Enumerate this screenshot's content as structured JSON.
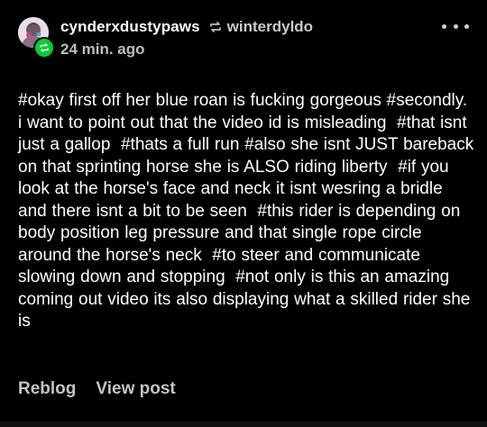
{
  "post": {
    "username": "cynderxdustypaws",
    "reblogged_from": "winterdyldo",
    "timestamp": "24 min. ago",
    "avatar_icon": "avatar-image",
    "badge_icon": "reblog-icon",
    "more_icon": "more-dots-icon",
    "tags": [
      "#okay first off her blue roan is fucking gorgeous",
      "#secondly. i want to point out that the video id is misleading",
      "#that isnt just a gallop",
      "#thats a full run",
      "#also she isnt JUST bareback on that sprinting horse she is ALSO riding liberty",
      "#if you look at the horse's face and neck it isnt wesring a bridle and there isnt a bit to be seen",
      "#this rider is depending on body position leg pressure and that single rope circle around the horse's neck",
      "#to steer and communicate slowing down and stopping",
      "#not only is this an amazing coming out video its also displaying what a skilled rider she is"
    ]
  },
  "footer": {
    "reblog_label": "Reblog",
    "view_post_label": "View post"
  },
  "colors": {
    "background": "#000000",
    "text": "#ffffff",
    "muted": "#c4c4c4",
    "reblog_green": "#00cf35"
  }
}
